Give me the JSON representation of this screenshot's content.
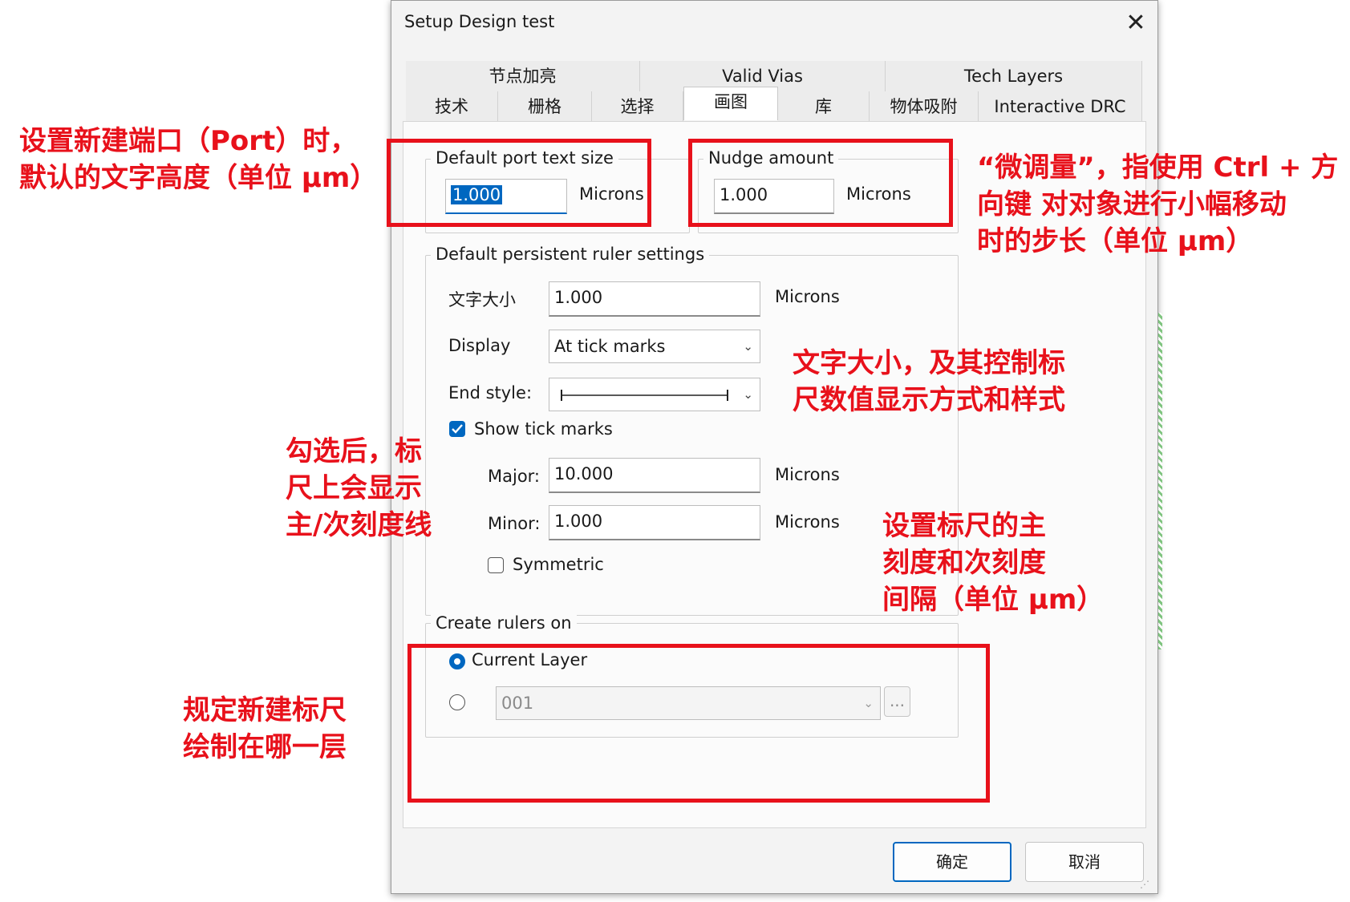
{
  "dialog": {
    "title": "Setup Design test",
    "close_glyph": "✕",
    "tabs_row1": [
      "节点加亮",
      "Valid Vias",
      "Tech Layers"
    ],
    "tabs_row2": [
      "技术",
      "栅格",
      "选择",
      "画图",
      "库",
      "物体吸附",
      "Interactive DRC"
    ],
    "active_tab": "画图"
  },
  "port_text": {
    "label": "Default port text size",
    "value": "1.000",
    "unit": "Microns"
  },
  "nudge": {
    "label": "Nudge amount",
    "value": "1.000",
    "unit": "Microns"
  },
  "ruler": {
    "group_label": "Default persistent ruler settings",
    "text_size_label": "文字大小",
    "text_size_value": "1.000",
    "text_size_unit": "Microns",
    "display_label": "Display",
    "display_value": "At tick marks",
    "end_style_label": "End style:",
    "show_ticks_label": "Show tick marks",
    "show_ticks_checked": true,
    "major_label": "Major:",
    "major_value": "10.000",
    "major_unit": "Microns",
    "minor_label": "Minor:",
    "minor_value": "1.000",
    "minor_unit": "Microns",
    "symmetric_label": "Symmetric",
    "symmetric_checked": false
  },
  "create_rulers": {
    "group_label": "Create rulers on",
    "current_layer_label": "Current Layer",
    "layer_value": "001",
    "browse_label": "..."
  },
  "buttons": {
    "ok": "确定",
    "cancel": "取消"
  },
  "annotations": {
    "port": [
      "设置新建端口（Port）时，",
      "默认的文字高度（单位 μm）"
    ],
    "nudge": [
      "“微调量”，指使用 Ctrl + 方",
      "向键 对对象进行小幅移动",
      "时的步长（单位 μm）"
    ],
    "text_size": [
      "文字大小，及其控制标",
      "尺数值显示方式和样式"
    ],
    "ticks": [
      "勾选后，标",
      "尺上会显示",
      "主/次刻度线"
    ],
    "spacing": [
      "设置标尺的主",
      "刻度和次刻度",
      "间隔（单位 μm）"
    ],
    "layer": [
      "规定新建标尺",
      "绘制在哪一层"
    ]
  },
  "colors": {
    "annotation_red": "#e8111b",
    "accent_blue": "#0067c0",
    "dialog_bg": "#f3f3f3"
  }
}
